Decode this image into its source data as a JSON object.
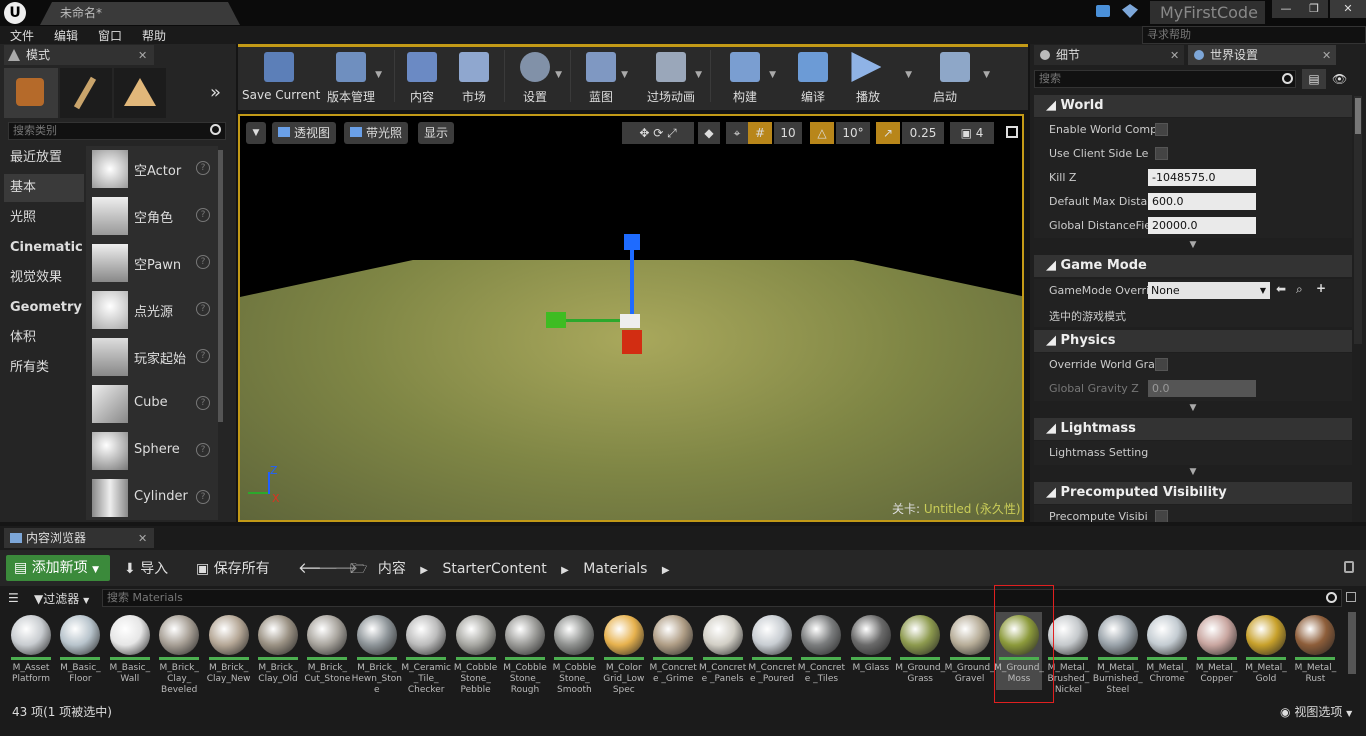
{
  "titlebar": {
    "doc_tab": "未命名*",
    "app_name": "MyFirstCode",
    "min": "—",
    "max": "❐",
    "close": "✕"
  },
  "menu": {
    "items": [
      "文件",
      "编辑",
      "窗口",
      "帮助"
    ],
    "help_search": "寻求帮助"
  },
  "modes": {
    "tab_label": "模式",
    "search_placeholder": "搜索类别",
    "categories": [
      "最近放置",
      "基本",
      "光照",
      "Cinematic",
      "视觉效果",
      "Geometry",
      "体积",
      "所有类"
    ],
    "selected_category": "基本",
    "actors": [
      "空Actor",
      "空角色",
      "空Pawn",
      "点光源",
      "玩家起始",
      "Cube",
      "Sphere",
      "Cylinder"
    ]
  },
  "toolbar": {
    "items": [
      "Save Current",
      "版本管理",
      "内容",
      "市场",
      "设置",
      "蓝图",
      "过场动画",
      "构建",
      "编译",
      "播放",
      "启动"
    ]
  },
  "viewport": {
    "perspective": "透视图",
    "lit": "带光照",
    "show": "显示",
    "grid_snap": "10",
    "rot_snap": "10°",
    "scale_snap": "0.25",
    "cam_speed": "4",
    "level_label": "关卡:",
    "level_name": "Untitled (永久性)",
    "axis_z": "Z",
    "axis_x": "X"
  },
  "details": {
    "tab_details": "细节",
    "tab_world": "世界设置",
    "search_placeholder": "搜索",
    "world": {
      "header": "World",
      "enable_world_comp": "Enable World Comp",
      "use_client_side": "Use Client Side Le",
      "kill_z_label": "Kill Z",
      "kill_z": "-1048575.0",
      "default_max_label": "Default Max Distar",
      "default_max": "600.0",
      "global_df_label": "Global DistanceFie",
      "global_df": "20000.0"
    },
    "game_mode": {
      "header": "Game Mode",
      "override_label": "GameMode Overri",
      "override_value": "None",
      "selected_label": "选中的游戏模式"
    },
    "physics": {
      "header": "Physics",
      "override_gravity": "Override World Gra",
      "global_gravity_label": "Global Gravity Z",
      "global_gravity": "0.0"
    },
    "lightmass": {
      "header": "Lightmass",
      "settings": "Lightmass Setting"
    },
    "precomputed": {
      "header": "Precomputed Visibility",
      "precompute": "Precompute Visibi"
    }
  },
  "content": {
    "tab_label": "内容浏览器",
    "add_new": "添加新项",
    "import": "导入",
    "save_all": "保存所有",
    "breadcrumb": [
      "内容",
      "StarterContent",
      "Materials"
    ],
    "filter": "过滤器",
    "search_placeholder": "搜索 Materials",
    "assets": [
      {
        "name": "M_Asset Platform",
        "color": "#c8ccd0"
      },
      {
        "name": "M_Basic_ Floor",
        "color": "#b8c4cc"
      },
      {
        "name": "M_Basic_ Wall",
        "color": "#e6e6e6"
      },
      {
        "name": "M_Brick_ Clay_ Beveled",
        "color": "#a79f95"
      },
      {
        "name": "M_Brick_ Clay_New",
        "color": "#b5a796"
      },
      {
        "name": "M_Brick_ Clay_Old",
        "color": "#9b9284"
      },
      {
        "name": "M_Brick_ Cut_Stone",
        "color": "#a9a59e"
      },
      {
        "name": "M_Brick_ Hewn_Stone",
        "color": "#8e9599"
      },
      {
        "name": "M_Ceramic _Tile_ Checker",
        "color": "#bcbcbc"
      },
      {
        "name": "M_Cobble Stone_ Pebble",
        "color": "#a8a8a3"
      },
      {
        "name": "M_Cobble Stone_ Rough",
        "color": "#9a9a97"
      },
      {
        "name": "M_Cobble Stone_ Smooth",
        "color": "#8f918f"
      },
      {
        "name": "M_Color Grid_Low Spec",
        "color": "#e7b24e"
      },
      {
        "name": "M_Concrete _Grime",
        "color": "#b09e86"
      },
      {
        "name": "M_Concrete _Panels",
        "color": "#d2cfc6"
      },
      {
        "name": "M_Concrete _Poured",
        "color": "#c8cdd2"
      },
      {
        "name": "M_Concrete _Tiles",
        "color": "#7b7d7e"
      },
      {
        "name": "M_Glass",
        "color": "#6a6a6a"
      },
      {
        "name": "M_Ground_ Grass",
        "color": "#8d9a4e"
      },
      {
        "name": "M_Ground_ Gravel",
        "color": "#b7ad98"
      },
      {
        "name": "M_Ground_ Moss",
        "color": "#8c9a3b"
      },
      {
        "name": "M_Metal_ Brushed_ Nickel",
        "color": "#c5c9cc"
      },
      {
        "name": "M_Metal_ Burnished_ Steel",
        "color": "#9aa3aa"
      },
      {
        "name": "M_Metal_ Chrome",
        "color": "#c4ccd2"
      },
      {
        "name": "M_Metal_ Copper",
        "color": "#c9a6a0"
      },
      {
        "name": "M_Metal_ Gold",
        "color": "#c8a12b"
      },
      {
        "name": "M_Metal_ Rust",
        "color": "#8e5e3a"
      }
    ],
    "status": "43 项(1 项被选中)",
    "view_options": "视图选项"
  }
}
